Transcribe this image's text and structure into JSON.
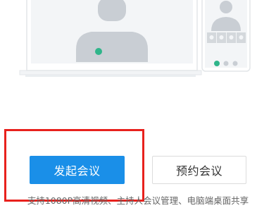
{
  "illustration": {
    "icons": [
      "person-silhouette-icon",
      "microphone-icon",
      "video-camera-icon",
      "share-screen-icon",
      "more-icon"
    ]
  },
  "actions": {
    "start_meeting_label": "发起会议",
    "schedule_meeting_label": "预约会议"
  },
  "feature_description": "支持1080P高清视频、主持人会议管理、电脑端桌面共享",
  "colors": {
    "primary": "#1a8fe8",
    "annotation": "#e8211d",
    "control_green": "#2fb58a"
  }
}
